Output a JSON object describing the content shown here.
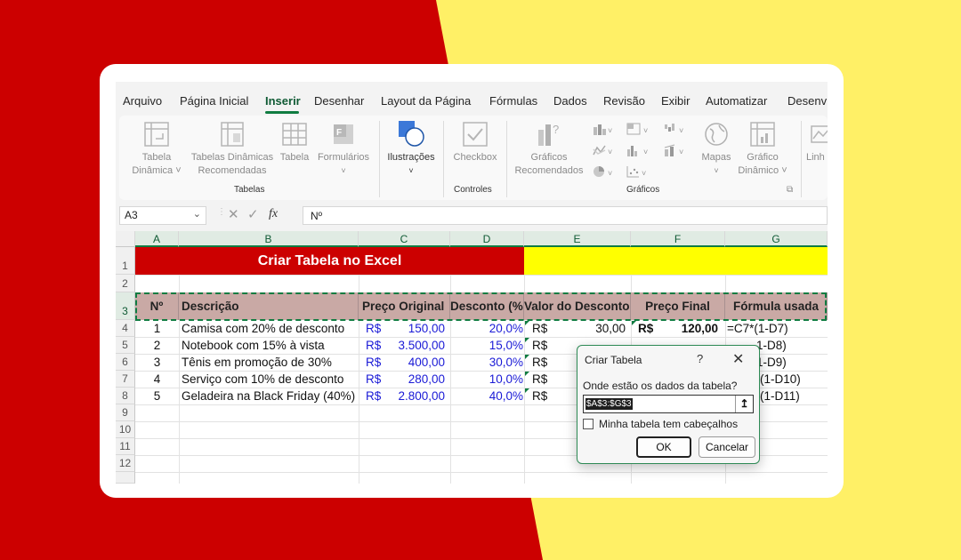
{
  "tabs": [
    "Arquivo",
    "Página Inicial",
    "Inserir",
    "Desenhar",
    "Layout da Página",
    "Fórmulas",
    "Dados",
    "Revisão",
    "Exibir",
    "Automatizar",
    "Desenv"
  ],
  "active_tab": "Inserir",
  "ribbon": {
    "tabela_dinamica": [
      "Tabela",
      "Dinâmica ˅"
    ],
    "tabelas_recomendadas": [
      "Tabelas Dinâmicas",
      "Recomendadas"
    ],
    "tabela": "Tabela",
    "formularios": "Formulários",
    "ilustracoes": "Ilustrações",
    "checkbox": "Checkbox",
    "graficos_recomendados": [
      "Gráficos",
      "Recomendados"
    ],
    "mapas": "Mapas",
    "grafico_dinamico": [
      "Gráfico",
      "Dinâmico ˅"
    ],
    "linha": "Linh",
    "group_tabelas": "Tabelas",
    "group_controles": "Controles",
    "group_graficos": "Gráficos"
  },
  "formula_bar": {
    "name_box": "A3",
    "fx": "fx",
    "content": "Nº"
  },
  "columns": [
    "A",
    "B",
    "C",
    "D",
    "E",
    "F",
    "G"
  ],
  "rows": [
    "1",
    "2",
    "3",
    "4",
    "5",
    "6",
    "7",
    "8",
    "9",
    "10",
    "11",
    "12"
  ],
  "title": "Criar Tabela no Excel",
  "headers": [
    "Nº",
    "Descrição",
    "Preço Original",
    "Desconto (%",
    "Valor do Desconto",
    "Preço Final",
    "Fórmula usada"
  ],
  "data_rows": [
    {
      "n": "1",
      "desc": "Camisa com 20% de desconto",
      "cur": "R$",
      "preco": "150,00",
      "desconto": "20,0%",
      "vcur": "R$",
      "valor": "30,00",
      "fcur": "R$",
      "final": "120,00",
      "formula": "=C7*(1-D7)"
    },
    {
      "n": "2",
      "desc": "Notebook com 15% à vista",
      "cur": "R$",
      "preco": "3.500,00",
      "desconto": "15,0%",
      "vcur": "R$",
      "valor": "",
      "fcur": "",
      "final": "",
      "formula": "1-D8)"
    },
    {
      "n": "3",
      "desc": "Tênis em promoção de 30%",
      "cur": "R$",
      "preco": "400,00",
      "desconto": "30,0%",
      "vcur": "R$",
      "valor": "",
      "fcur": "",
      "final": "",
      "formula": "1-D9)"
    },
    {
      "n": "4",
      "desc": "Serviço com 10% de desconto",
      "cur": "R$",
      "preco": "280,00",
      "desconto": "10,0%",
      "vcur": "R$",
      "valor": "",
      "fcur": "",
      "final": "",
      "formula": "(1-D10)"
    },
    {
      "n": "5",
      "desc": "Geladeira na Black Friday (40%)",
      "cur": "R$",
      "preco": "2.800,00",
      "desconto": "40,0%",
      "vcur": "R$",
      "valor": "",
      "fcur": "",
      "final": "",
      "formula": "(1-D11)"
    }
  ],
  "dialog": {
    "title": "Criar Tabela",
    "help": "?",
    "label": "Onde estão os dados da tabela?",
    "range": "$A$3:$G$3",
    "checkbox_label": "Minha tabela tem cabeçalhos",
    "ok": "OK",
    "cancel": "Cancelar"
  },
  "colors": {
    "title_bg": "#cc0000",
    "yellow": "#ffff00",
    "header_bg": "#c9a9a5",
    "excel_green": "#107c41"
  }
}
